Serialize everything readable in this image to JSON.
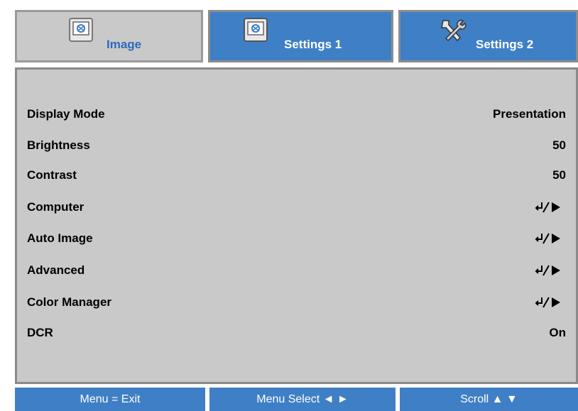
{
  "tabs": [
    {
      "label": "Image",
      "icon": "image-icon",
      "active": true
    },
    {
      "label": "Settings 1",
      "icon": "image-icon",
      "active": false
    },
    {
      "label": "Settings 2",
      "icon": "tools-icon",
      "active": false
    }
  ],
  "menu": {
    "items": [
      {
        "label": "Display Mode",
        "value": "Presentation"
      },
      {
        "label": "Brightness",
        "value": "50"
      },
      {
        "label": "Contrast",
        "value": "50"
      },
      {
        "label": "Computer",
        "value": "",
        "icon": "enter-arrow-icon"
      },
      {
        "label": "Auto Image",
        "value": "",
        "icon": "enter-arrow-icon"
      },
      {
        "label": "Advanced",
        "value": "",
        "icon": "enter-arrow-icon"
      },
      {
        "label": "Color Manager",
        "value": "",
        "icon": "enter-arrow-icon"
      },
      {
        "label": "DCR",
        "value": "On"
      }
    ]
  },
  "footer": {
    "exit": "Menu = Exit",
    "select": "Menu Select ◄ ►",
    "scroll": "Scroll ▲ ▼"
  },
  "colors": {
    "accent_blue": "#3f7fc6",
    "panel_gray": "#c9c9c9",
    "active_label": "#2c6bbf"
  }
}
